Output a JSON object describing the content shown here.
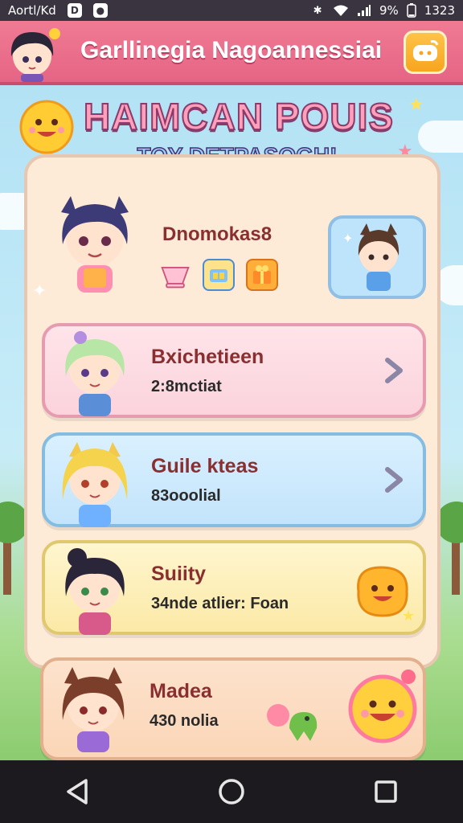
{
  "status_bar": {
    "carrier": "Aortl/Kd",
    "battery_text": "9%",
    "time": "1323"
  },
  "header": {
    "title": "Garllinegia Nagoannessiai"
  },
  "banner": {
    "title": "HAIMCAN POUIS",
    "subtitle": "TOY DETPASOGH!"
  },
  "profile": {
    "name": "Dnomokas8"
  },
  "cards": [
    {
      "title": "Bxichetieen",
      "subtitle": "2:8mctiat"
    },
    {
      "title": "Guile kteas",
      "subtitle": "83ooolial"
    },
    {
      "title": "Suiity",
      "subtitle": "34nde atlier: Foan"
    },
    {
      "title": "Madea",
      "subtitle": "430 nolia"
    }
  ],
  "colors": {
    "header": "#e56584",
    "accent_orange": "#f7a51e",
    "card_pink": "#fbd3dc",
    "card_blue": "#c3e4fb",
    "card_yellow": "#fbe9a6",
    "card_peach": "#fbd6b7"
  }
}
